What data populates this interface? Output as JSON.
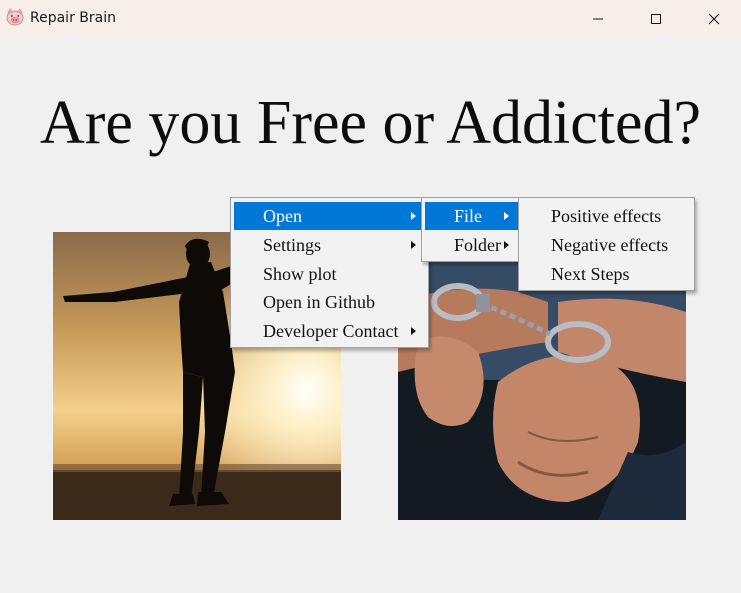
{
  "window": {
    "title": "Repair Brain",
    "icon": "pig-face-icon",
    "controls": [
      "minimize-icon",
      "maximize-icon",
      "close-icon"
    ]
  },
  "headline": "Are you Free or Addicted?",
  "images": [
    {
      "name": "woman-silhouette-sunset-photo",
      "meaning": "free"
    },
    {
      "name": "handcuffed-hands-photo",
      "meaning": "addicted"
    }
  ],
  "menus": {
    "main": [
      {
        "label": "Open",
        "submenu": true,
        "active": true
      },
      {
        "label": "Settings",
        "submenu": true
      },
      {
        "label": "Show plot",
        "submenu": false
      },
      {
        "label": "Open in Github",
        "submenu": false
      },
      {
        "label": "Developer Contact",
        "submenu": true
      }
    ],
    "open": [
      {
        "label": "File",
        "submenu": true,
        "active": true
      },
      {
        "label": "Folder",
        "submenu": true
      }
    ],
    "file": [
      {
        "label": "Positive effects"
      },
      {
        "label": "Negative effects"
      },
      {
        "label": "Next Steps"
      }
    ]
  },
  "colors": {
    "titlebar": "#f6efe8",
    "background": "#f0f0f0",
    "menu_highlight": "#0078d7",
    "menu_background": "#f2f2f2"
  }
}
